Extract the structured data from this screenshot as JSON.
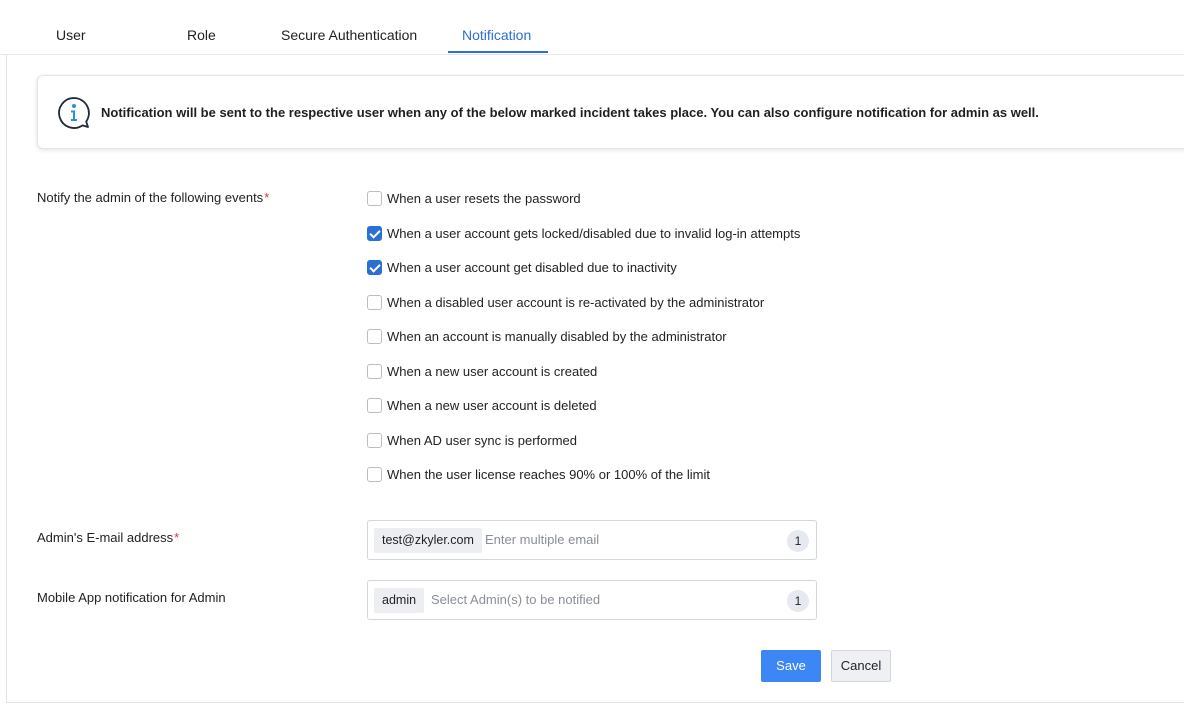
{
  "tabs": [
    {
      "label": "User",
      "active": false
    },
    {
      "label": "Role",
      "active": false
    },
    {
      "label": "Secure Authentication",
      "active": false
    },
    {
      "label": "Notification",
      "active": true
    }
  ],
  "info": {
    "icon": "info-icon",
    "text": "Notification will be sent to the respective user when any of the below marked incident takes place. You can also configure notification for admin as well."
  },
  "events": {
    "label": "Notify the admin of the following events",
    "required_mark": "*",
    "options": [
      {
        "label": "When a user resets the password",
        "checked": false
      },
      {
        "label": "When a user account gets locked/disabled due to invalid log-in attempts",
        "checked": true
      },
      {
        "label": "When a user account get disabled due to inactivity",
        "checked": true
      },
      {
        "label": "When a disabled user account is re-activated by the administrator",
        "checked": false
      },
      {
        "label": "When an account is manually disabled by the administrator",
        "checked": false
      },
      {
        "label": "When a new user account is created",
        "checked": false
      },
      {
        "label": "When a new user account is deleted",
        "checked": false
      },
      {
        "label": "When AD user sync is performed",
        "checked": false
      },
      {
        "label": "When the user license reaches 90% or 100% of the limit",
        "checked": false
      }
    ]
  },
  "email": {
    "label": "Admin's E-mail address",
    "required_mark": "*",
    "chip": "test@zkyler.com",
    "placeholder": "Enter multiple email",
    "count": "1"
  },
  "mobile": {
    "label": "Mobile App notification for Admin",
    "chip": "admin",
    "placeholder": "Select Admin(s) to be notified",
    "count": "1"
  },
  "actions": {
    "save_label": "Save",
    "cancel_label": "Cancel"
  },
  "colors": {
    "accent": "#2b6fd6",
    "save_button": "#3d86f5",
    "required": "#d9363e"
  }
}
